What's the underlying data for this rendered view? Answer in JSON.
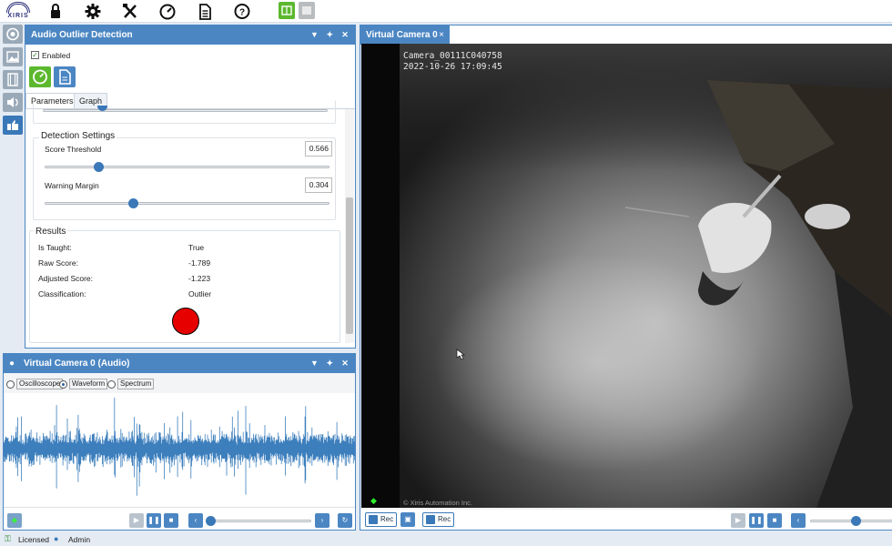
{
  "app": {
    "logo_text": "XIRIS",
    "toolbar_icons": [
      "lock-icon",
      "gear-icon",
      "tools-icon",
      "gauge-icon",
      "document-icon",
      "help-icon"
    ],
    "accent": "#4b86c3"
  },
  "sidebar": {
    "items": [
      "camera-lens-icon",
      "image-icon",
      "film-icon",
      "speaker-icon",
      "plugin-icon"
    ]
  },
  "outlier_panel": {
    "title": "Audio Outlier Detection",
    "enabled_label": "Enabled",
    "enabled": true,
    "tabs": [
      {
        "label": "Parameters"
      },
      {
        "label": "Graph"
      }
    ],
    "detection_settings": {
      "title": "Detection Settings",
      "score_threshold": {
        "label": "Score Threshold",
        "value": "0.566",
        "fraction": 0.19
      },
      "warning_margin": {
        "label": "Warning Margin",
        "value": "0.304",
        "fraction": 0.31
      }
    },
    "results": {
      "title": "Results",
      "rows": [
        {
          "label": "Is Taught:",
          "value": "True"
        },
        {
          "label": "Raw Score:",
          "value": "-1.789"
        },
        {
          "label": "Adjusted Score:",
          "value": "-1.223"
        },
        {
          "label": "Classification:",
          "value": "Outlier"
        }
      ],
      "indicator_color": "#e60000"
    }
  },
  "audio_panel": {
    "title": "Virtual Camera 0 (Audio)",
    "modes": [
      {
        "label": "Oscilloscope",
        "selected": false
      },
      {
        "label": "Waveform",
        "selected": true
      },
      {
        "label": "Spectrum",
        "selected": false
      }
    ],
    "waveform_color": "#3d7fbd"
  },
  "camera_panel": {
    "tab_label": "Virtual Camera 0",
    "close_label": "×",
    "overlay_line1": "Camera_00111C040758",
    "overlay_line2": "2022-10-26 17:09:45",
    "watermark": "© Xiris Automation Inc.",
    "rec_buttons": [
      {
        "label": "Rec"
      },
      {
        "label": "Rec"
      }
    ]
  },
  "status": {
    "license": "Licensed",
    "user": "Admin"
  }
}
